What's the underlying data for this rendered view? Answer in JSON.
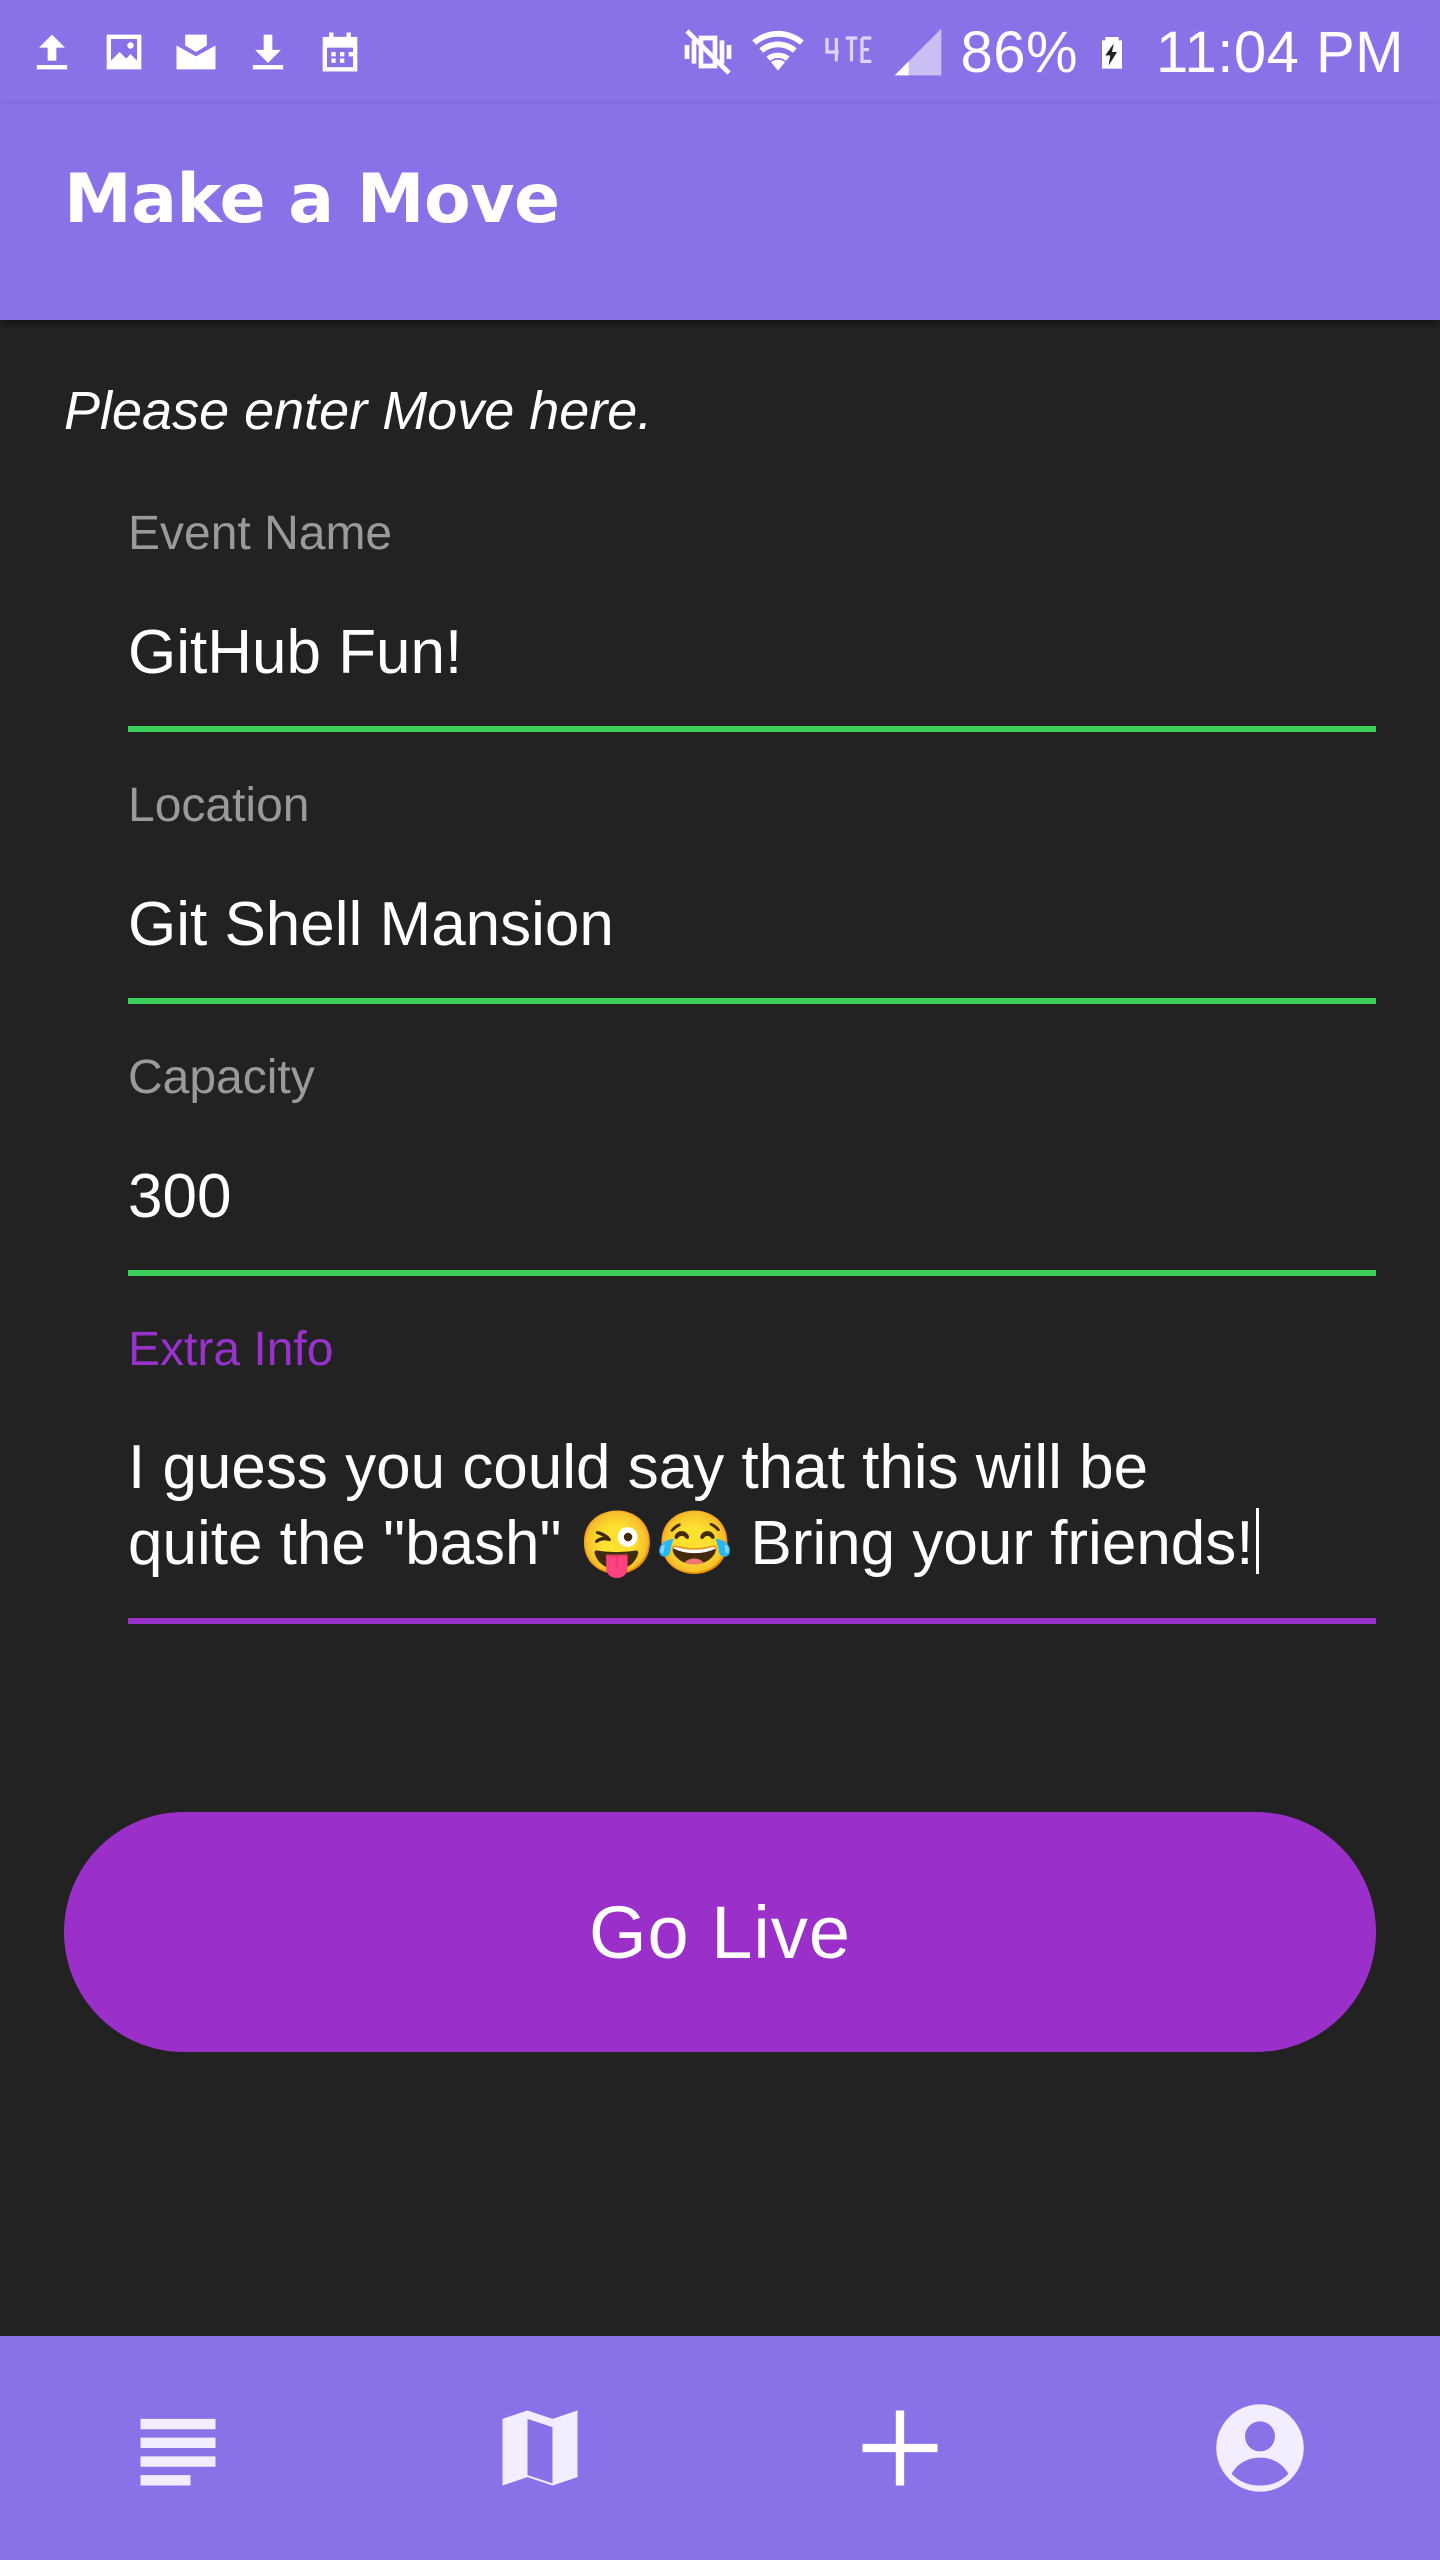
{
  "status_bar": {
    "battery": "86%",
    "time": "11:04 PM",
    "icons_left": [
      "upload-icon",
      "image-icon",
      "mail-check-icon",
      "download-icon",
      "calendar-icon"
    ],
    "icons_right": [
      "vibrate-mute-icon",
      "wifi-icon",
      "4g-lte-icon",
      "signal-icon",
      "battery-charging-icon"
    ]
  },
  "app_bar": {
    "title": "Make a Move"
  },
  "form": {
    "instructions": "Please enter Move here.",
    "event_name": {
      "label": "Event Name",
      "value": "GitHub Fun!"
    },
    "location": {
      "label": "Location",
      "value": "Git Shell Mansion"
    },
    "capacity": {
      "label": "Capacity",
      "value": "300"
    },
    "extra_info": {
      "label": "Extra Info",
      "value": "I guess you could say that this will be\nquite the \"bash\" 😜😂 Bring your friends!"
    },
    "submit_label": "Go Live"
  },
  "bottom_nav": {
    "items": [
      "list-icon",
      "map-icon",
      "add-icon",
      "account-icon"
    ]
  },
  "colors": {
    "primary": "#8a71e8",
    "accent": "#9a2fc9",
    "field_underline": "#3ccf5a",
    "background": "#222222"
  }
}
